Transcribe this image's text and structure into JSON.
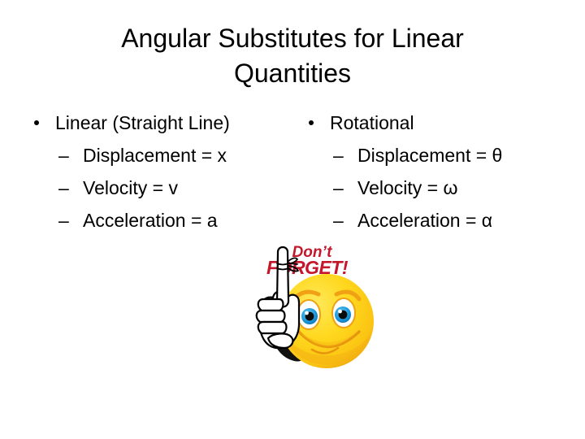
{
  "slide": {
    "background_color": "#ffffff",
    "title": {
      "line1": "Angular Substitutes for Linear",
      "line2": "Quantities"
    },
    "columns": [
      {
        "heading": "Linear (Straight Line)",
        "bullet_glyph": "•",
        "sub_bullet_glyph": "–",
        "items": [
          "Displacement = x",
          "Velocity = v",
          "Acceleration = a"
        ]
      },
      {
        "heading": "Rotational",
        "bullet_glyph": "•",
        "sub_bullet_glyph": "–",
        "items": [
          "Displacement = θ",
          "Velocity = ω",
          "Acceleration = α"
        ]
      }
    ],
    "clipart": {
      "name": "dont-forget-smiley-with-string-on-finger",
      "caption_line1": "Don’t",
      "caption_line2": "FORGET!",
      "caption_color": "#c4172c",
      "face_color": "#ffd21a",
      "face_shadow_color": "#f0a81e",
      "eye_iris_color": "#1e9bdd",
      "glove_color": "#ffffff",
      "outline_color": "#000000"
    }
  }
}
